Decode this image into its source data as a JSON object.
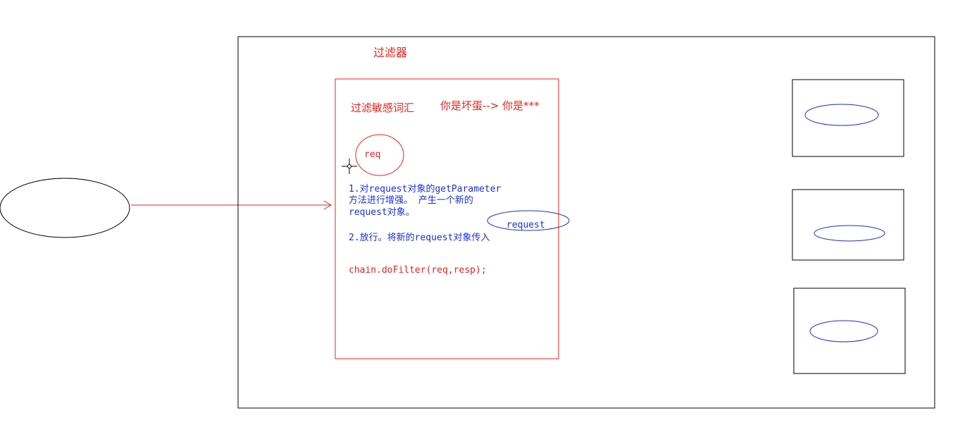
{
  "diagram": {
    "title": "过滤器",
    "topic": "过滤敏感词汇",
    "example": "你是坏蛋--> 你是***",
    "req_label": "req",
    "steps": [
      "1.对request对象的getParameter",
      "方法进行增强。  产生一个新的",
      "request对象。",
      "2.放行。将新的request对象传入"
    ],
    "code": "chain.doFilter(req,resp);",
    "request_label": "request"
  },
  "colors": {
    "filter": "#e8231a",
    "note": "#1a2fd6",
    "frame": "#000000"
  }
}
